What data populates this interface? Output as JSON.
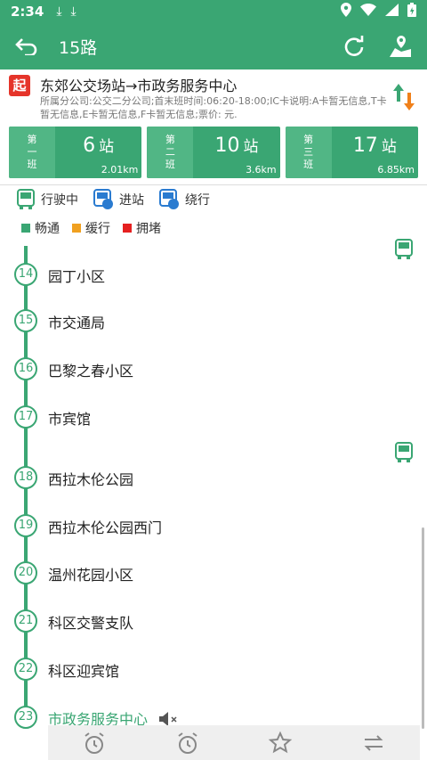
{
  "status_bar": {
    "time": "2:34"
  },
  "app_bar": {
    "title": "15路"
  },
  "route": {
    "badge": "起",
    "name": "东郊公交场站→市政务服务中心",
    "detail": "所属分公司:公交二分公司;首末班时间:06:20-18:00;IC卡说明:A卡暂无信息,T卡暂无信息,E卡暂无信息,F卡暂无信息;票价:  元."
  },
  "bus_cards": [
    {
      "label": [
        "第",
        "一",
        "班"
      ],
      "stops": "6",
      "unit": "站",
      "distance": "2.01km"
    },
    {
      "label": [
        "第",
        "二",
        "班"
      ],
      "stops": "10",
      "unit": "站",
      "distance": "3.6km"
    },
    {
      "label": [
        "第",
        "三",
        "班"
      ],
      "stops": "17",
      "unit": "站",
      "distance": "6.85km"
    }
  ],
  "legend_status": [
    {
      "label": "行驶中",
      "icon": "bus-icon"
    },
    {
      "label": "进站",
      "icon": "bus-arriving-icon"
    },
    {
      "label": "绕行",
      "icon": "bus-detour-icon"
    }
  ],
  "legend_traffic": [
    {
      "label": "畅通",
      "color": "#3aa673"
    },
    {
      "label": "缓行",
      "color": "#f0a020"
    },
    {
      "label": "拥堵",
      "color": "#e52020"
    }
  ],
  "colors": {
    "primary": "#3aa673",
    "origin_badge": "#e5342a"
  },
  "stops": [
    {
      "num": "14",
      "name": "园丁小区"
    },
    {
      "num": "15",
      "name": "市交通局"
    },
    {
      "num": "16",
      "name": "巴黎之春小区"
    },
    {
      "num": "17",
      "name": "市宾馆"
    },
    {
      "num": "18",
      "name": "西拉木伦公园"
    },
    {
      "num": "19",
      "name": "西拉木伦公园西门"
    },
    {
      "num": "20",
      "name": "温州花园小区"
    },
    {
      "num": "21",
      "name": "科区交警支队"
    },
    {
      "num": "22",
      "name": "科区迎宾馆"
    },
    {
      "num": "23",
      "name": "市政务服务中心"
    }
  ]
}
